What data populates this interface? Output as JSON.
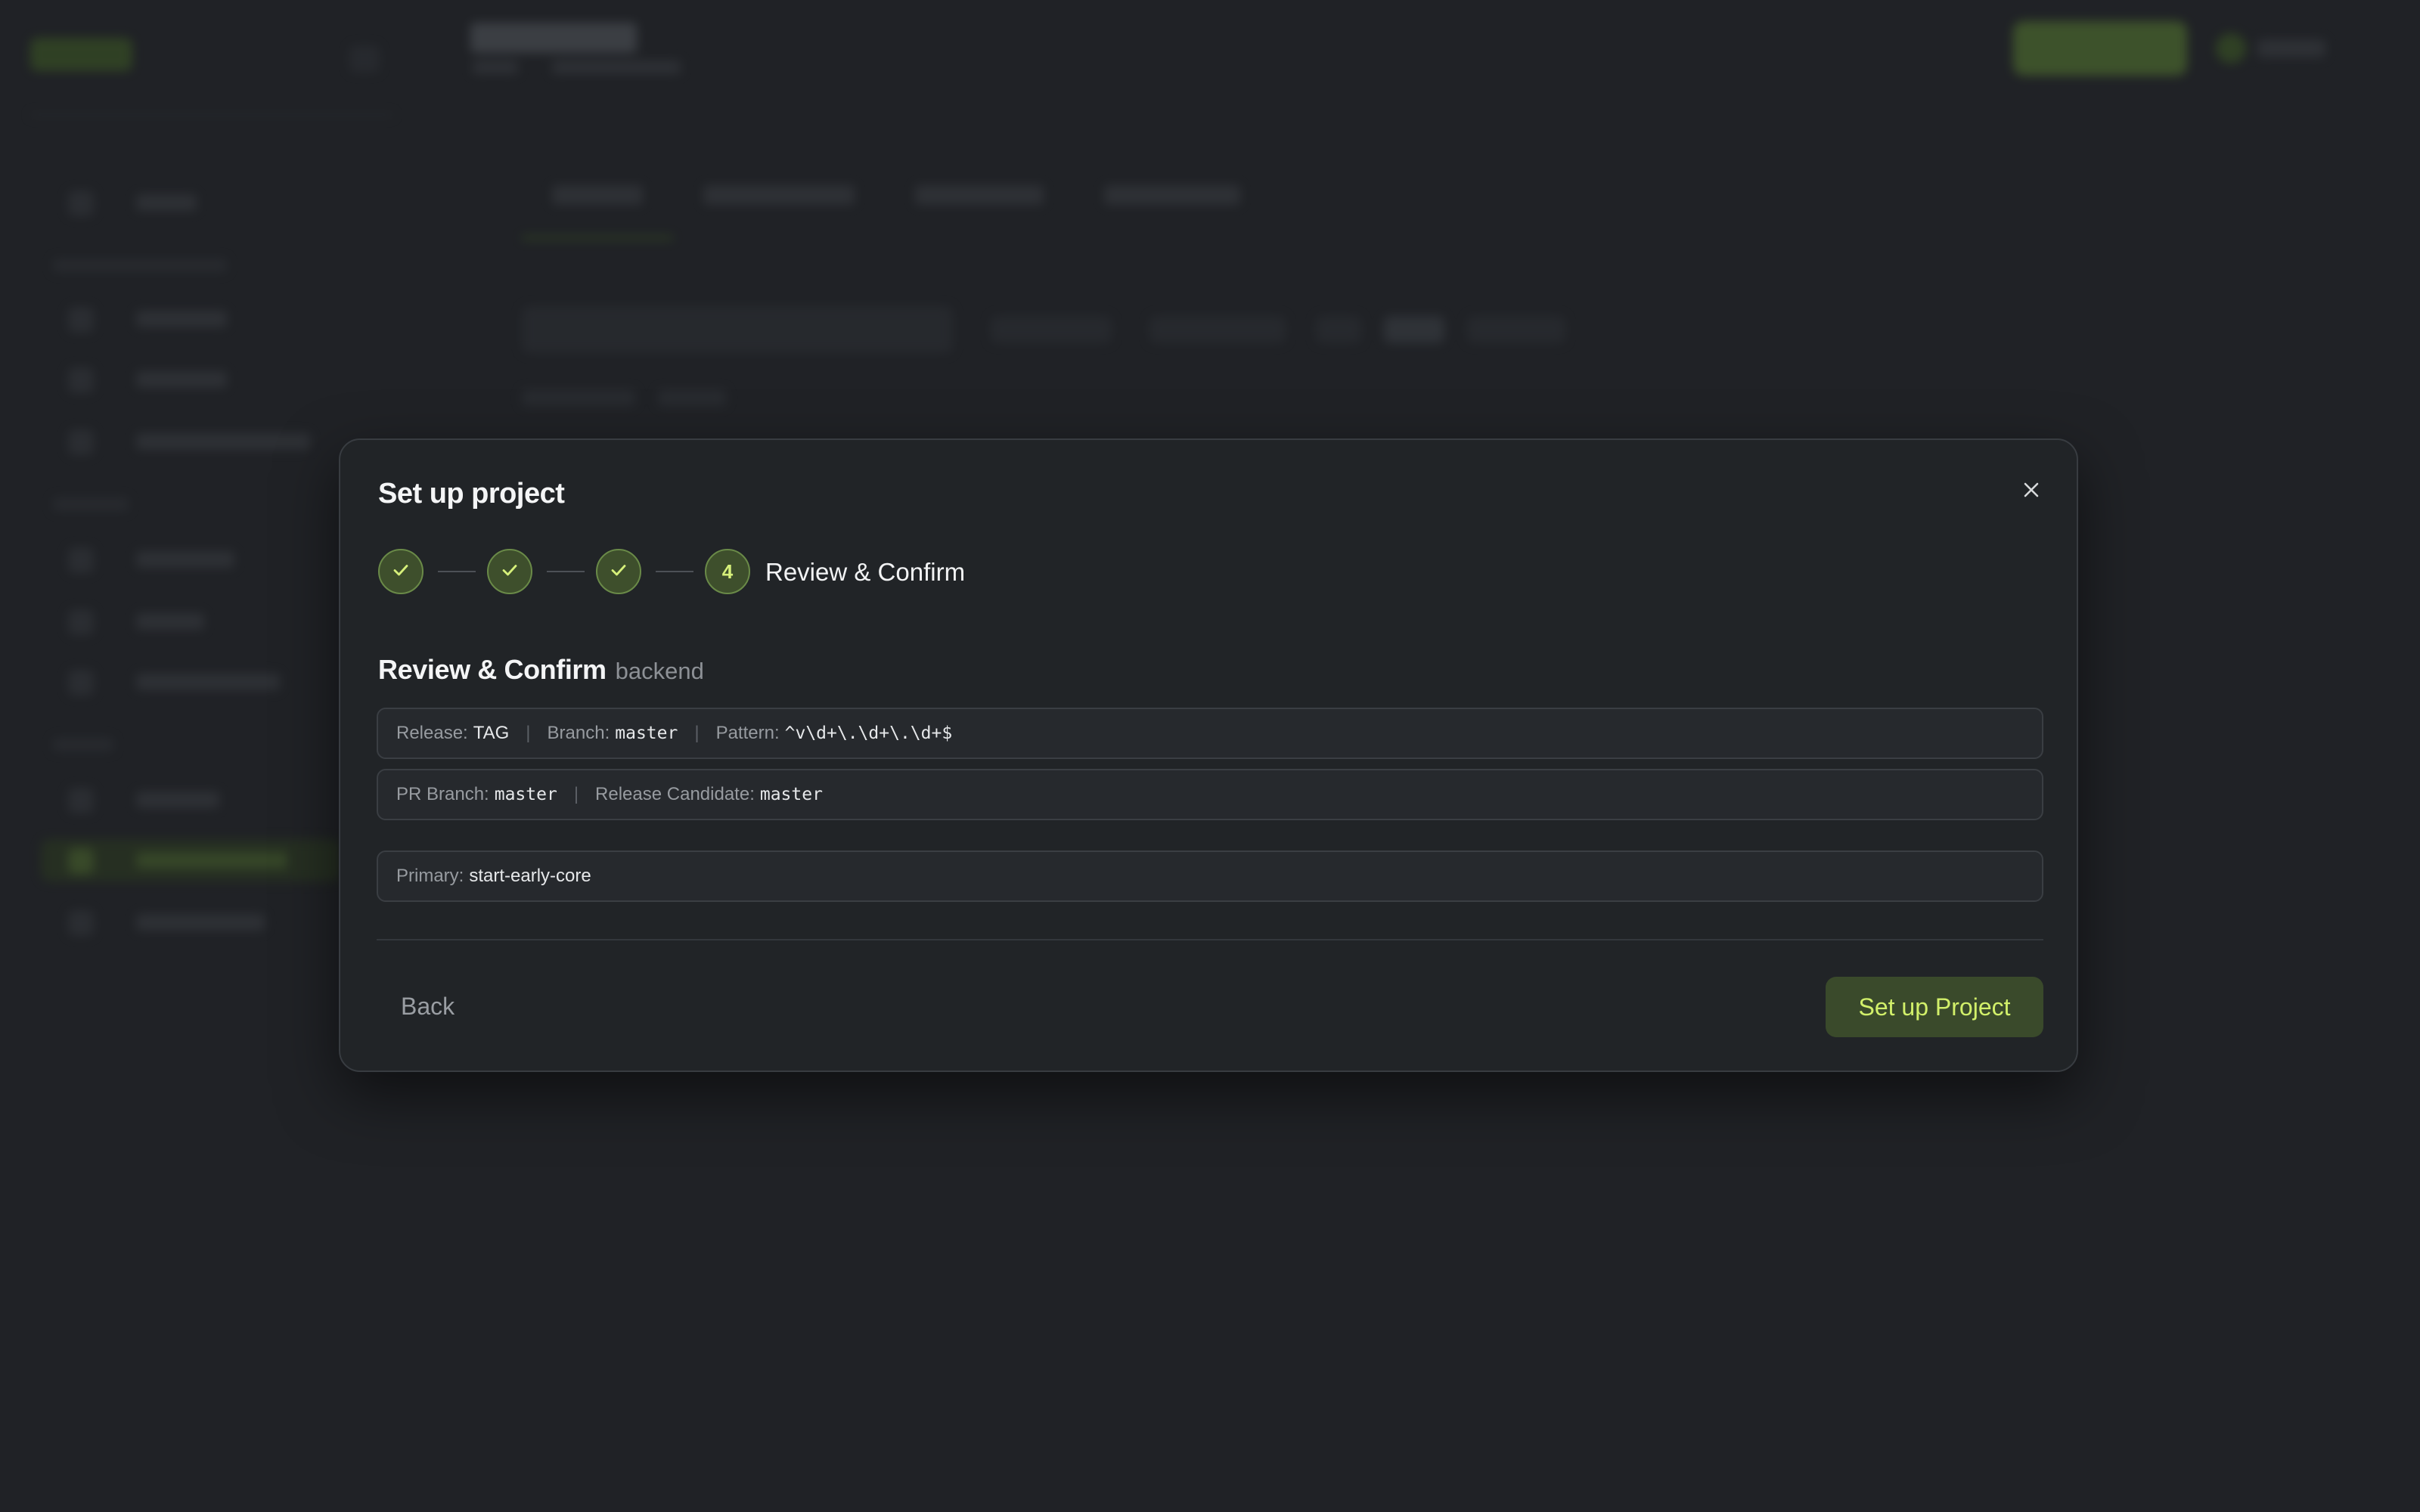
{
  "modal": {
    "title": "Set up project",
    "close_icon": "close-icon",
    "stepper": {
      "completed_icon": "check-icon",
      "steps": [
        {
          "state": "complete"
        },
        {
          "state": "complete"
        },
        {
          "state": "complete"
        },
        {
          "state": "current",
          "number": "4",
          "label": "Review & Confirm"
        }
      ]
    },
    "section": {
      "title": "Review & Confirm",
      "subtitle": "backend"
    },
    "summary": {
      "row1": {
        "release_key": "Release:",
        "release_value": "TAG",
        "branch_key": "Branch:",
        "branch_value": "master",
        "pattern_key": "Pattern:",
        "pattern_value": "^v\\d+\\.\\d+\\.\\d+$"
      },
      "row2": {
        "pr_branch_key": "PR Branch:",
        "pr_branch_value": "master",
        "rc_key": "Release Candidate:",
        "rc_value": "master"
      },
      "row3": {
        "primary_key": "Primary:",
        "primary_value": "start-early-core"
      },
      "separator": "|"
    },
    "footer": {
      "back_label": "Back",
      "submit_label": "Set up Project"
    }
  },
  "colors": {
    "accent": "#d2f06a",
    "accent_bg": "#3a4a2b",
    "step_border": "#6a8a48",
    "modal_bg": "#212427",
    "page_bg": "#202226"
  }
}
